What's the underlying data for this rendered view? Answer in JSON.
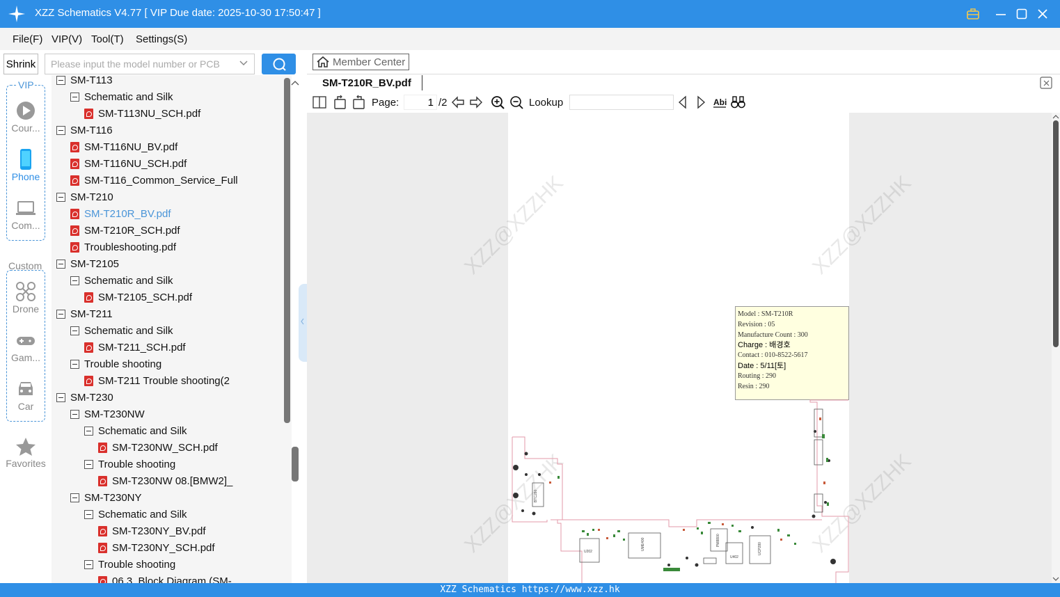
{
  "app": {
    "title": "XZZ Schematics V4.77 [ VIP Due date: 2025-10-30 17:50:47 ]",
    "accent_color": "#2f8fe6"
  },
  "menu": [
    "File(F)",
    "VIP(V)",
    "Tool(T)",
    "Settings(S)"
  ],
  "search": {
    "shrink_label": "Shrink",
    "placeholder": "Please input the model number or PCB",
    "button_icon": "search-icon"
  },
  "leftnav": {
    "vip_label": "VIP",
    "custom_label": "Custom",
    "vip_items": [
      {
        "label": "Cour...",
        "icon": "play-circle-icon"
      },
      {
        "label": "Phone",
        "icon": "phone-icon"
      },
      {
        "label": "Com...",
        "icon": "laptop-icon"
      }
    ],
    "custom_items": [
      {
        "label": "Drone",
        "icon": "drone-icon"
      },
      {
        "label": "Gam...",
        "icon": "gamepad-icon"
      },
      {
        "label": "Car",
        "icon": "car-icon"
      }
    ],
    "favorites_label": "Favorites"
  },
  "tree": [
    {
      "label": "SM-T113",
      "type": "folder",
      "level": 0
    },
    {
      "label": "Schematic and Silk",
      "type": "folder",
      "level": 1
    },
    {
      "label": "SM-T113NU_SCH.pdf",
      "type": "pdf",
      "level": 2
    },
    {
      "label": "SM-T116",
      "type": "folder",
      "level": 0
    },
    {
      "label": "SM-T116NU_BV.pdf",
      "type": "pdf",
      "level": 1
    },
    {
      "label": "SM-T116NU_SCH.pdf",
      "type": "pdf",
      "level": 1
    },
    {
      "label": "SM-T116_Common_Service_Full",
      "type": "pdf",
      "level": 1
    },
    {
      "label": "SM-T210",
      "type": "folder",
      "level": 0
    },
    {
      "label": "SM-T210R_BV.pdf",
      "type": "pdf",
      "level": 1,
      "selected": true
    },
    {
      "label": "SM-T210R_SCH.pdf",
      "type": "pdf",
      "level": 1
    },
    {
      "label": "Troubleshooting.pdf",
      "type": "pdf",
      "level": 1
    },
    {
      "label": "SM-T2105",
      "type": "folder",
      "level": 0
    },
    {
      "label": "Schematic and Silk",
      "type": "folder",
      "level": 1
    },
    {
      "label": "SM-T2105_SCH.pdf",
      "type": "pdf",
      "level": 2
    },
    {
      "label": "SM-T211",
      "type": "folder",
      "level": 0
    },
    {
      "label": "Schematic and Silk",
      "type": "folder",
      "level": 1
    },
    {
      "label": "SM-T211_SCH.pdf",
      "type": "pdf",
      "level": 2
    },
    {
      "label": "Trouble shooting",
      "type": "folder",
      "level": 1
    },
    {
      "label": "SM-T211 Trouble shooting(2",
      "type": "pdf",
      "level": 2
    },
    {
      "label": "SM-T230",
      "type": "folder",
      "level": 0
    },
    {
      "label": "SM-T230NW",
      "type": "folder",
      "level": 1
    },
    {
      "label": "Schematic and Silk",
      "type": "folder",
      "level": 2
    },
    {
      "label": "SM-T230NW_SCH.pdf",
      "type": "pdf",
      "level": 3
    },
    {
      "label": "Trouble shooting",
      "type": "folder",
      "level": 2
    },
    {
      "label": "SM-T230NW 08.[BMW2]_",
      "type": "pdf",
      "level": 3
    },
    {
      "label": "SM-T230NY",
      "type": "folder",
      "level": 1
    },
    {
      "label": "Schematic and Silk",
      "type": "folder",
      "level": 2
    },
    {
      "label": "SM-T230NY_BV.pdf",
      "type": "pdf",
      "level": 3
    },
    {
      "label": "SM-T230NY_SCH.pdf",
      "type": "pdf",
      "level": 3
    },
    {
      "label": "Trouble shooting",
      "type": "folder",
      "level": 2
    },
    {
      "label": "06.3_Block Diagram (SM-",
      "type": "pdf",
      "level": 3
    }
  ],
  "viewer": {
    "member_center": "Member Center",
    "tab_name": "SM-T210R_BV.pdf",
    "page_label": "Page:",
    "page_current": "1",
    "page_total": "/2",
    "lookup_label": "Lookup",
    "watermark": "XZZ@XZZHK",
    "info": [
      {
        "text": "Model : SM-T210R",
        "bold": false
      },
      {
        "text": "Revision : 05",
        "bold": false
      },
      {
        "text": "Manufacture Count : 300",
        "bold": false
      },
      {
        "text": "Charge : 배경호",
        "bold": true
      },
      {
        "text": "Contact : 010-8522-5617",
        "bold": false
      },
      {
        "text": "Date : 5/11[토]",
        "bold": true
      },
      {
        "text": "Routing : 290",
        "bold": false
      },
      {
        "text": "Resin : 290",
        "bold": false
      }
    ],
    "board_labels": [
      "BTC280",
      "U202",
      "UME400",
      "PM8800",
      "U402",
      "UCP280"
    ]
  },
  "status": {
    "text": "XZZ Schematics https://www.xzz.hk"
  }
}
